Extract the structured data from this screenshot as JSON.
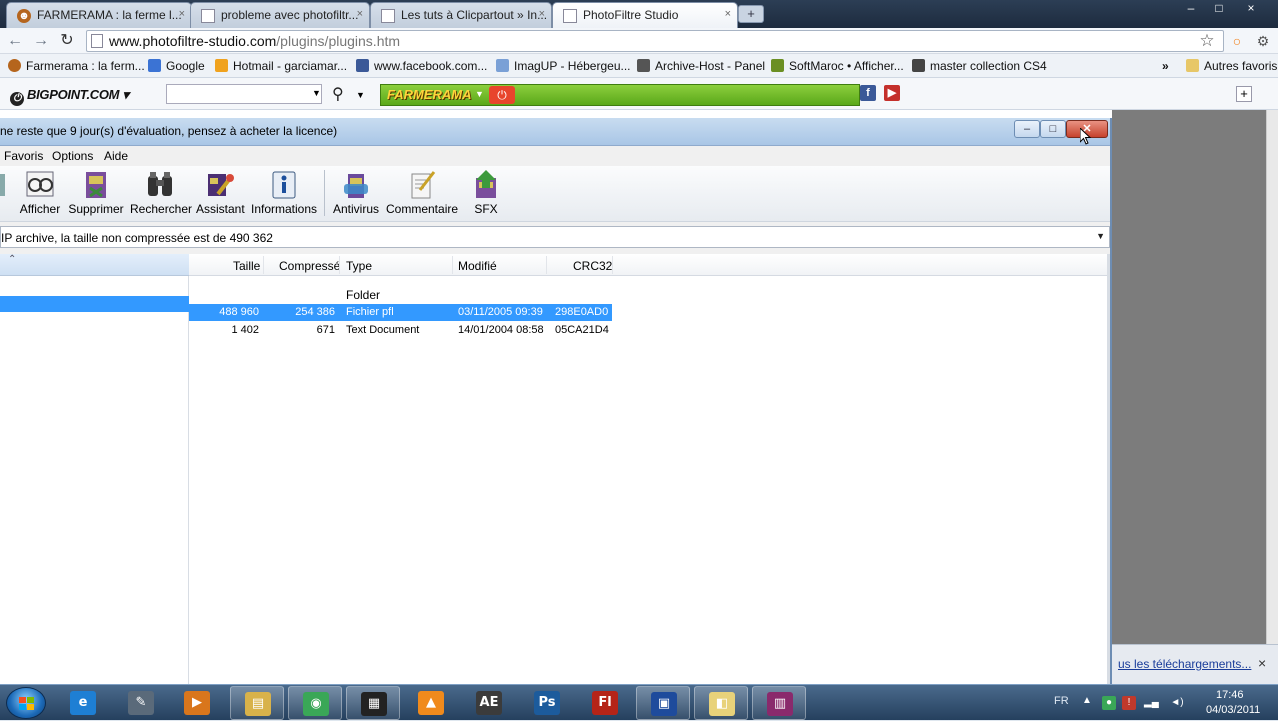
{
  "browser": {
    "tabs": [
      {
        "label": "FARMERAMA : la ferme l...",
        "close": "×"
      },
      {
        "label": "probleme avec photofiltr...",
        "close": "×"
      },
      {
        "label": "Les tuts à Clicpartout » In...",
        "close": "×"
      },
      {
        "label": "PhotoFiltre Studio",
        "close": "×"
      }
    ],
    "new_tab": "+",
    "window_controls": [
      "–",
      "□",
      "×"
    ],
    "nav": {
      "back": "←",
      "forward": "→",
      "reload": "↻"
    },
    "url_domain": "www.photofiltre-studio.com",
    "url_path": "/plugins/plugins.htm",
    "star": "☆",
    "bookmarks": [
      {
        "label": "Farmerama : la ferm...",
        "color": "#b5651d"
      },
      {
        "label": "Google",
        "color": "#3b73d4"
      },
      {
        "label": "Hotmail - garciamar...",
        "color": "#f0a21e"
      },
      {
        "label": "www.facebook.com...",
        "color": "#3b5998"
      },
      {
        "label": "ImagUP - Hébergeu...",
        "color": "#7aa0d6"
      },
      {
        "label": "Archive-Host - Panel",
        "color": "#555555"
      },
      {
        "label": "SoftMaroc • Afficher...",
        "color": "#6b8f23"
      },
      {
        "label": "master collection CS4",
        "color": "#444444"
      }
    ],
    "bookmarks_more": "»",
    "other_bookmarks": "Autres favoris"
  },
  "bigpoint_toolbar": {
    "logo": "BIGPOINT.COM",
    "search_value": "",
    "farmerama_label": "FARMERAMA"
  },
  "app": {
    "title": "ne reste que 9 jour(s) d'évaluation, pensez à acheter la licence)",
    "menu": [
      "Favoris",
      "Options",
      "Aide"
    ],
    "toolbar": [
      {
        "label": "Afficher",
        "icon": "view-icon"
      },
      {
        "label": "Supprimer",
        "icon": "delete-icon"
      },
      {
        "label": "Rechercher",
        "icon": "find-icon"
      },
      {
        "label": "Assistant",
        "icon": "wizard-icon"
      },
      {
        "label": "Informations",
        "icon": "info-icon"
      },
      {
        "label": "Antivirus",
        "icon": "antivirus-icon"
      },
      {
        "label": "Commentaire",
        "icon": "comment-icon"
      },
      {
        "label": "SFX",
        "icon": "sfx-icon"
      }
    ],
    "address_text": "IP archive, la taille non compressée est de 490 362",
    "columns": [
      "Taille",
      "Compressé",
      "Type",
      "Modifié",
      "CRC32"
    ],
    "rows": [
      {
        "size": "",
        "packed": "",
        "type": "Folder",
        "modified": "",
        "crc": "",
        "selected": false
      },
      {
        "size": "488 960",
        "packed": "254 386",
        "type": "Fichier pfl",
        "modified": "03/11/2005 09:39",
        "crc": "298E0AD0",
        "selected": true
      },
      {
        "size": "1 402",
        "packed": "671",
        "type": "Text Document",
        "modified": "14/01/2004 08:58",
        "crc": "05CA21D4",
        "selected": false
      }
    ]
  },
  "downloads_bar": {
    "link": "us les téléchargements...",
    "close": "×"
  },
  "taskbar": {
    "apps": [
      {
        "name": "ie",
        "glyph": "e",
        "color": "#1e7fd4"
      },
      {
        "name": "tools",
        "glyph": "✎",
        "color": "#5a6a7a"
      },
      {
        "name": "media",
        "glyph": "▶",
        "color": "#d9761c"
      },
      {
        "name": "explorer",
        "glyph": "▤",
        "color": "#d8b24a"
      },
      {
        "name": "chrome",
        "glyph": "◉",
        "color": "#3aa757"
      },
      {
        "name": "studio",
        "glyph": "▦",
        "color": "#222222"
      },
      {
        "name": "vlc",
        "glyph": "▲",
        "color": "#f08a1c"
      },
      {
        "name": "ae",
        "glyph": "AE",
        "color": "#3b3b3b"
      },
      {
        "name": "ps",
        "glyph": "Ps",
        "color": "#1c5b9c"
      },
      {
        "name": "fl",
        "glyph": "Fl",
        "color": "#b52418"
      },
      {
        "name": "sel",
        "glyph": "▣",
        "color": "#1e4b9c"
      },
      {
        "name": "folder",
        "glyph": "◧",
        "color": "#e8d27a"
      },
      {
        "name": "winrar",
        "glyph": "▥",
        "color": "#8a2a6c"
      }
    ],
    "lang": "FR",
    "time": "17:46",
    "date": "04/03/2011"
  }
}
